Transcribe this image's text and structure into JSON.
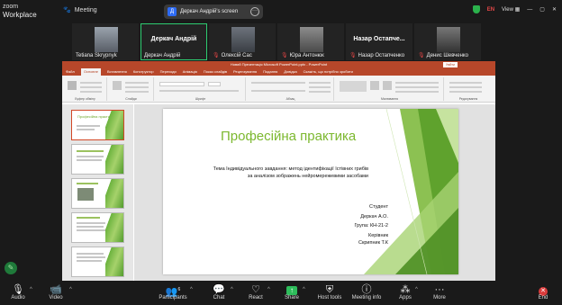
{
  "app": {
    "brand_top": "zoom",
    "brand_bottom": "Workplace",
    "meeting_label": "Meeting"
  },
  "share_badge": {
    "initial": "Д",
    "label": "Деркач Андрій's screen",
    "menu": "···"
  },
  "top_right": {
    "language": "EN",
    "view": "View"
  },
  "participants": [
    {
      "name": "Tetiana Skrypnyk",
      "muted": false
    },
    {
      "name": "Деркач Андрій",
      "display_name": "Деркач Андрій",
      "active": true
    },
    {
      "name": "Олексій Сас",
      "muted": true
    },
    {
      "name": "Юра Антонюк",
      "muted": true
    },
    {
      "name": "Назар Остапченко",
      "display_name": "Назар Остапче...",
      "muted": true
    },
    {
      "name": "Денис Шевченко",
      "muted": true
    }
  ],
  "powerpoint": {
    "window_title": "Новий Презентація Microsoft PowerPoint.pptx  -  PowerPoint",
    "sign_in": "Увійти",
    "tabs": [
      "Файл",
      "Основне",
      "Вставлення",
      "Конструктор",
      "Переходи",
      "Анімація",
      "Показ слайдів",
      "Рецензування",
      "Подання",
      "Довідка",
      "Скажіть, що потрібно зробити"
    ],
    "selected_tab": "Основне",
    "ribbon_groups": [
      "Буфер обміну",
      "Слайди",
      "Шрифт",
      "Абзац",
      "Малювання",
      "Редагування"
    ],
    "slide": {
      "title": "Професійна практика",
      "subtitle_line1": "Тема Індивідуального завдання: метод ідентифікації їстівних грибів",
      "subtitle_line2": "за аналізом зображень нейромережевими засобами",
      "student_label": "Студент",
      "student_name": "Деркач А.О.",
      "group": "Група: КН-21-2",
      "supervisor_label": "Керівник",
      "supervisor_name": "Скрипник Т.К"
    },
    "thumbnail_numbers": [
      "1",
      "2",
      "3",
      "4",
      "5"
    ],
    "thumbnail_title": "Професійна практика",
    "accent_green": "#7cb82f",
    "accent_red": "#b7472a"
  },
  "toolbar": {
    "audio": "Audio",
    "video": "Video",
    "participants": "Participants",
    "participants_count": "6",
    "chat": "Chat",
    "react": "React",
    "share": "Share",
    "host_tools": "Host tools",
    "meeting_info": "Meeting info",
    "apps": "Apps",
    "more": "More",
    "end": "End"
  }
}
